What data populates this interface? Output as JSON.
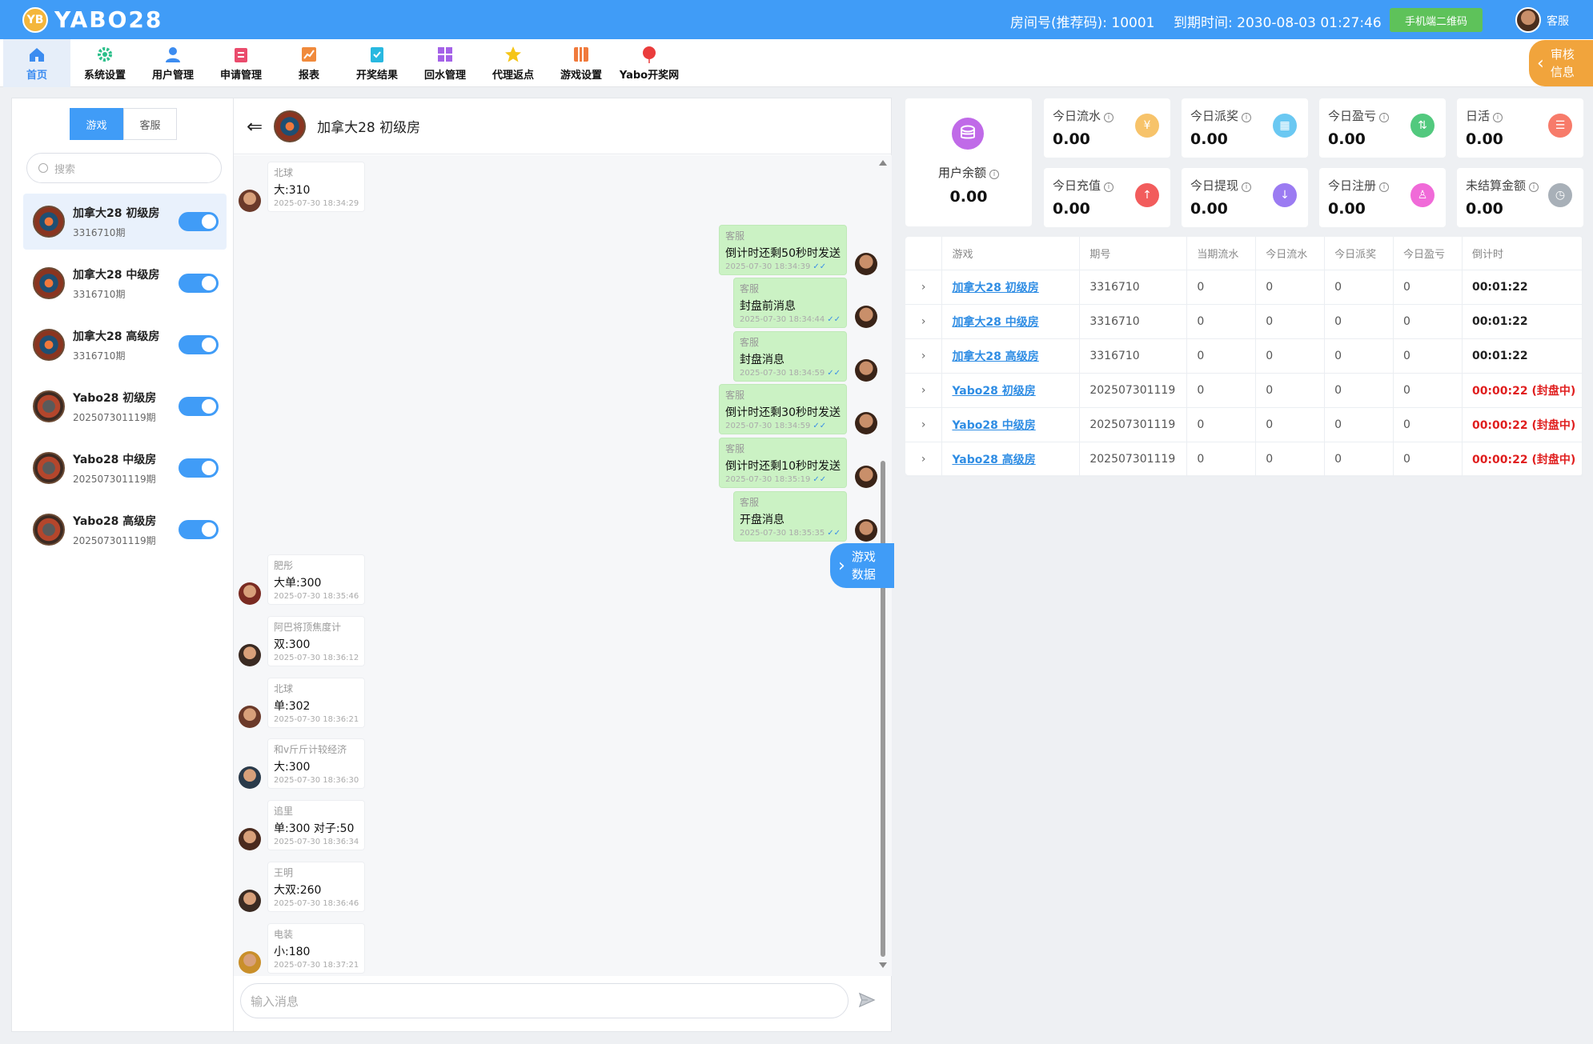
{
  "app": {
    "logo_badge": "YB",
    "logo_text": "YABO28"
  },
  "header": {
    "room_info": "房间号(推荐码): 10001",
    "expire_info": "到期时间: 2030-08-03 01:27:46",
    "qr_button": "手机端二维码",
    "user": "客服"
  },
  "nav": [
    {
      "label": "首页",
      "icon": "home-icon",
      "color": "#3c8cf0"
    },
    {
      "label": "系统设置",
      "icon": "gear-icon",
      "color": "#2bbf8a"
    },
    {
      "label": "用户管理",
      "icon": "user-icon",
      "color": "#3c8cf0"
    },
    {
      "label": "申请管理",
      "icon": "clipboard-icon",
      "color": "#ea4c6d"
    },
    {
      "label": "报表",
      "icon": "chart-icon",
      "color": "#f08a3c"
    },
    {
      "label": "开奖结果",
      "icon": "checklist-icon",
      "color": "#28b8e0"
    },
    {
      "label": "回水管理",
      "icon": "grid-icon",
      "color": "#a462e8"
    },
    {
      "label": "代理返点",
      "icon": "star-icon",
      "color": "#f5c518"
    },
    {
      "label": "游戏设置",
      "icon": "book-icon",
      "color": "#f07a3c"
    },
    {
      "label": "Yabo开奖网",
      "icon": "balloon-icon",
      "color": "#ea3c3c"
    }
  ],
  "review_tab": {
    "line1": "审核",
    "line2": "信息"
  },
  "left": {
    "tabs": [
      "游戏",
      "客服"
    ],
    "search_placeholder": "搜索",
    "rooms": [
      {
        "name": "加拿大28 初级房",
        "sub": "3316710期"
      },
      {
        "name": "加拿大28 中级房",
        "sub": "3316710期"
      },
      {
        "name": "加拿大28 高级房",
        "sub": "3316710期"
      },
      {
        "name": "Yabo28 初级房",
        "sub": "202507301119期"
      },
      {
        "name": "Yabo28 中级房",
        "sub": "202507301119期"
      },
      {
        "name": "Yabo28 高级房",
        "sub": "202507301119期"
      }
    ]
  },
  "chat": {
    "title": "加拿大28 初级房",
    "input_placeholder": "输入消息",
    "game_data_tab": {
      "line1": "游戏",
      "line2": "数据"
    },
    "messages": [
      {
        "dir": "in",
        "name": "北球",
        "text": "大:310",
        "time": "2025-07-30 18:34:29"
      },
      {
        "dir": "out",
        "name": "客服",
        "text": "倒计时还剩50秒时发送",
        "time": "2025-07-30 18:34:39"
      },
      {
        "dir": "out",
        "name": "客服",
        "text": "封盘前消息",
        "time": "2025-07-30 18:34:44"
      },
      {
        "dir": "out",
        "name": "客服",
        "text": "封盘消息",
        "time": "2025-07-30 18:34:59"
      },
      {
        "dir": "out",
        "name": "客服",
        "text": "倒计时还剩30秒时发送",
        "time": "2025-07-30 18:34:59"
      },
      {
        "dir": "out",
        "name": "客服",
        "text": "倒计时还剩10秒时发送",
        "time": "2025-07-30 18:35:19"
      },
      {
        "dir": "out",
        "name": "客服",
        "text": "开盘消息",
        "time": "2025-07-30 18:35:35"
      },
      {
        "dir": "in",
        "name": "肥彤",
        "text": "大单:300",
        "time": "2025-07-30 18:35:46"
      },
      {
        "dir": "in",
        "name": "阿巴将顶焦度计",
        "text": "双:300",
        "time": "2025-07-30 18:36:12"
      },
      {
        "dir": "in",
        "name": "北球",
        "text": "单:302",
        "time": "2025-07-30 18:36:21"
      },
      {
        "dir": "in",
        "name": "和v斤斤计较经济",
        "text": "大:300",
        "time": "2025-07-30 18:36:30"
      },
      {
        "dir": "in",
        "name": "追里",
        "text": "单:300 对子:50",
        "time": "2025-07-30 18:36:34"
      },
      {
        "dir": "in",
        "name": "王明",
        "text": "大双:260",
        "time": "2025-07-30 18:36:46"
      },
      {
        "dir": "in",
        "name": "电装",
        "text": "小:180",
        "time": "2025-07-30 18:37:21"
      }
    ]
  },
  "balance": {
    "label": "用户余额",
    "value": "0.00",
    "icon": "coins-icon",
    "color": "#c06ae8"
  },
  "stats": [
    {
      "label": "今日流水",
      "value": "0.00",
      "icon": "money-icon",
      "color": "#f7c36a",
      "glyph": "¥"
    },
    {
      "label": "今日派奖",
      "value": "0.00",
      "icon": "gift-icon",
      "color": "#6ac8f2",
      "glyph": "▦"
    },
    {
      "label": "今日盈亏",
      "value": "0.00",
      "icon": "updown-icon",
      "color": "#52c97e",
      "glyph": "⇅"
    },
    {
      "label": "日活",
      "value": "0.00",
      "icon": "activity-icon",
      "color": "#f77b6a",
      "glyph": "☰"
    },
    {
      "label": "今日充值",
      "value": "0.00",
      "icon": "upload-icon",
      "color": "#f25c5c",
      "glyph": "↑"
    },
    {
      "label": "今日提现",
      "value": "0.00",
      "icon": "download-icon",
      "color": "#9b7bf2",
      "glyph": "↓"
    },
    {
      "label": "今日注册",
      "value": "0.00",
      "icon": "user-add-icon",
      "color": "#f06ad8",
      "glyph": "♙"
    },
    {
      "label": "未结算金额",
      "value": "0.00",
      "icon": "clock-icon",
      "color": "#a8b0b8",
      "glyph": "◷"
    }
  ],
  "table": {
    "headers": [
      "",
      "游戏",
      "期号",
      "当期流水",
      "今日流水",
      "今日派奖",
      "今日盈亏",
      "倒计时"
    ],
    "rows": [
      {
        "game": "加拿大28 初级房",
        "period": "3316710",
        "c1": "0",
        "c2": "0",
        "c3": "0",
        "c4": "0",
        "countdown": "00:01:22",
        "closed": false
      },
      {
        "game": "加拿大28 中级房",
        "period": "3316710",
        "c1": "0",
        "c2": "0",
        "c3": "0",
        "c4": "0",
        "countdown": "00:01:22",
        "closed": false
      },
      {
        "game": "加拿大28 高级房",
        "period": "3316710",
        "c1": "0",
        "c2": "0",
        "c3": "0",
        "c4": "0",
        "countdown": "00:01:22",
        "closed": false
      },
      {
        "game": "Yabo28 初级房",
        "period": "202507301119",
        "c1": "0",
        "c2": "0",
        "c3": "0",
        "c4": "0",
        "countdown": "00:00:22 (封盘中)",
        "closed": true
      },
      {
        "game": "Yabo28 中级房",
        "period": "202507301119",
        "c1": "0",
        "c2": "0",
        "c3": "0",
        "c4": "0",
        "countdown": "00:00:22 (封盘中)",
        "closed": true
      },
      {
        "game": "Yabo28 高级房",
        "period": "202507301119",
        "c1": "0",
        "c2": "0",
        "c3": "0",
        "c4": "0",
        "countdown": "00:00:22 (封盘中)",
        "closed": true
      }
    ]
  }
}
